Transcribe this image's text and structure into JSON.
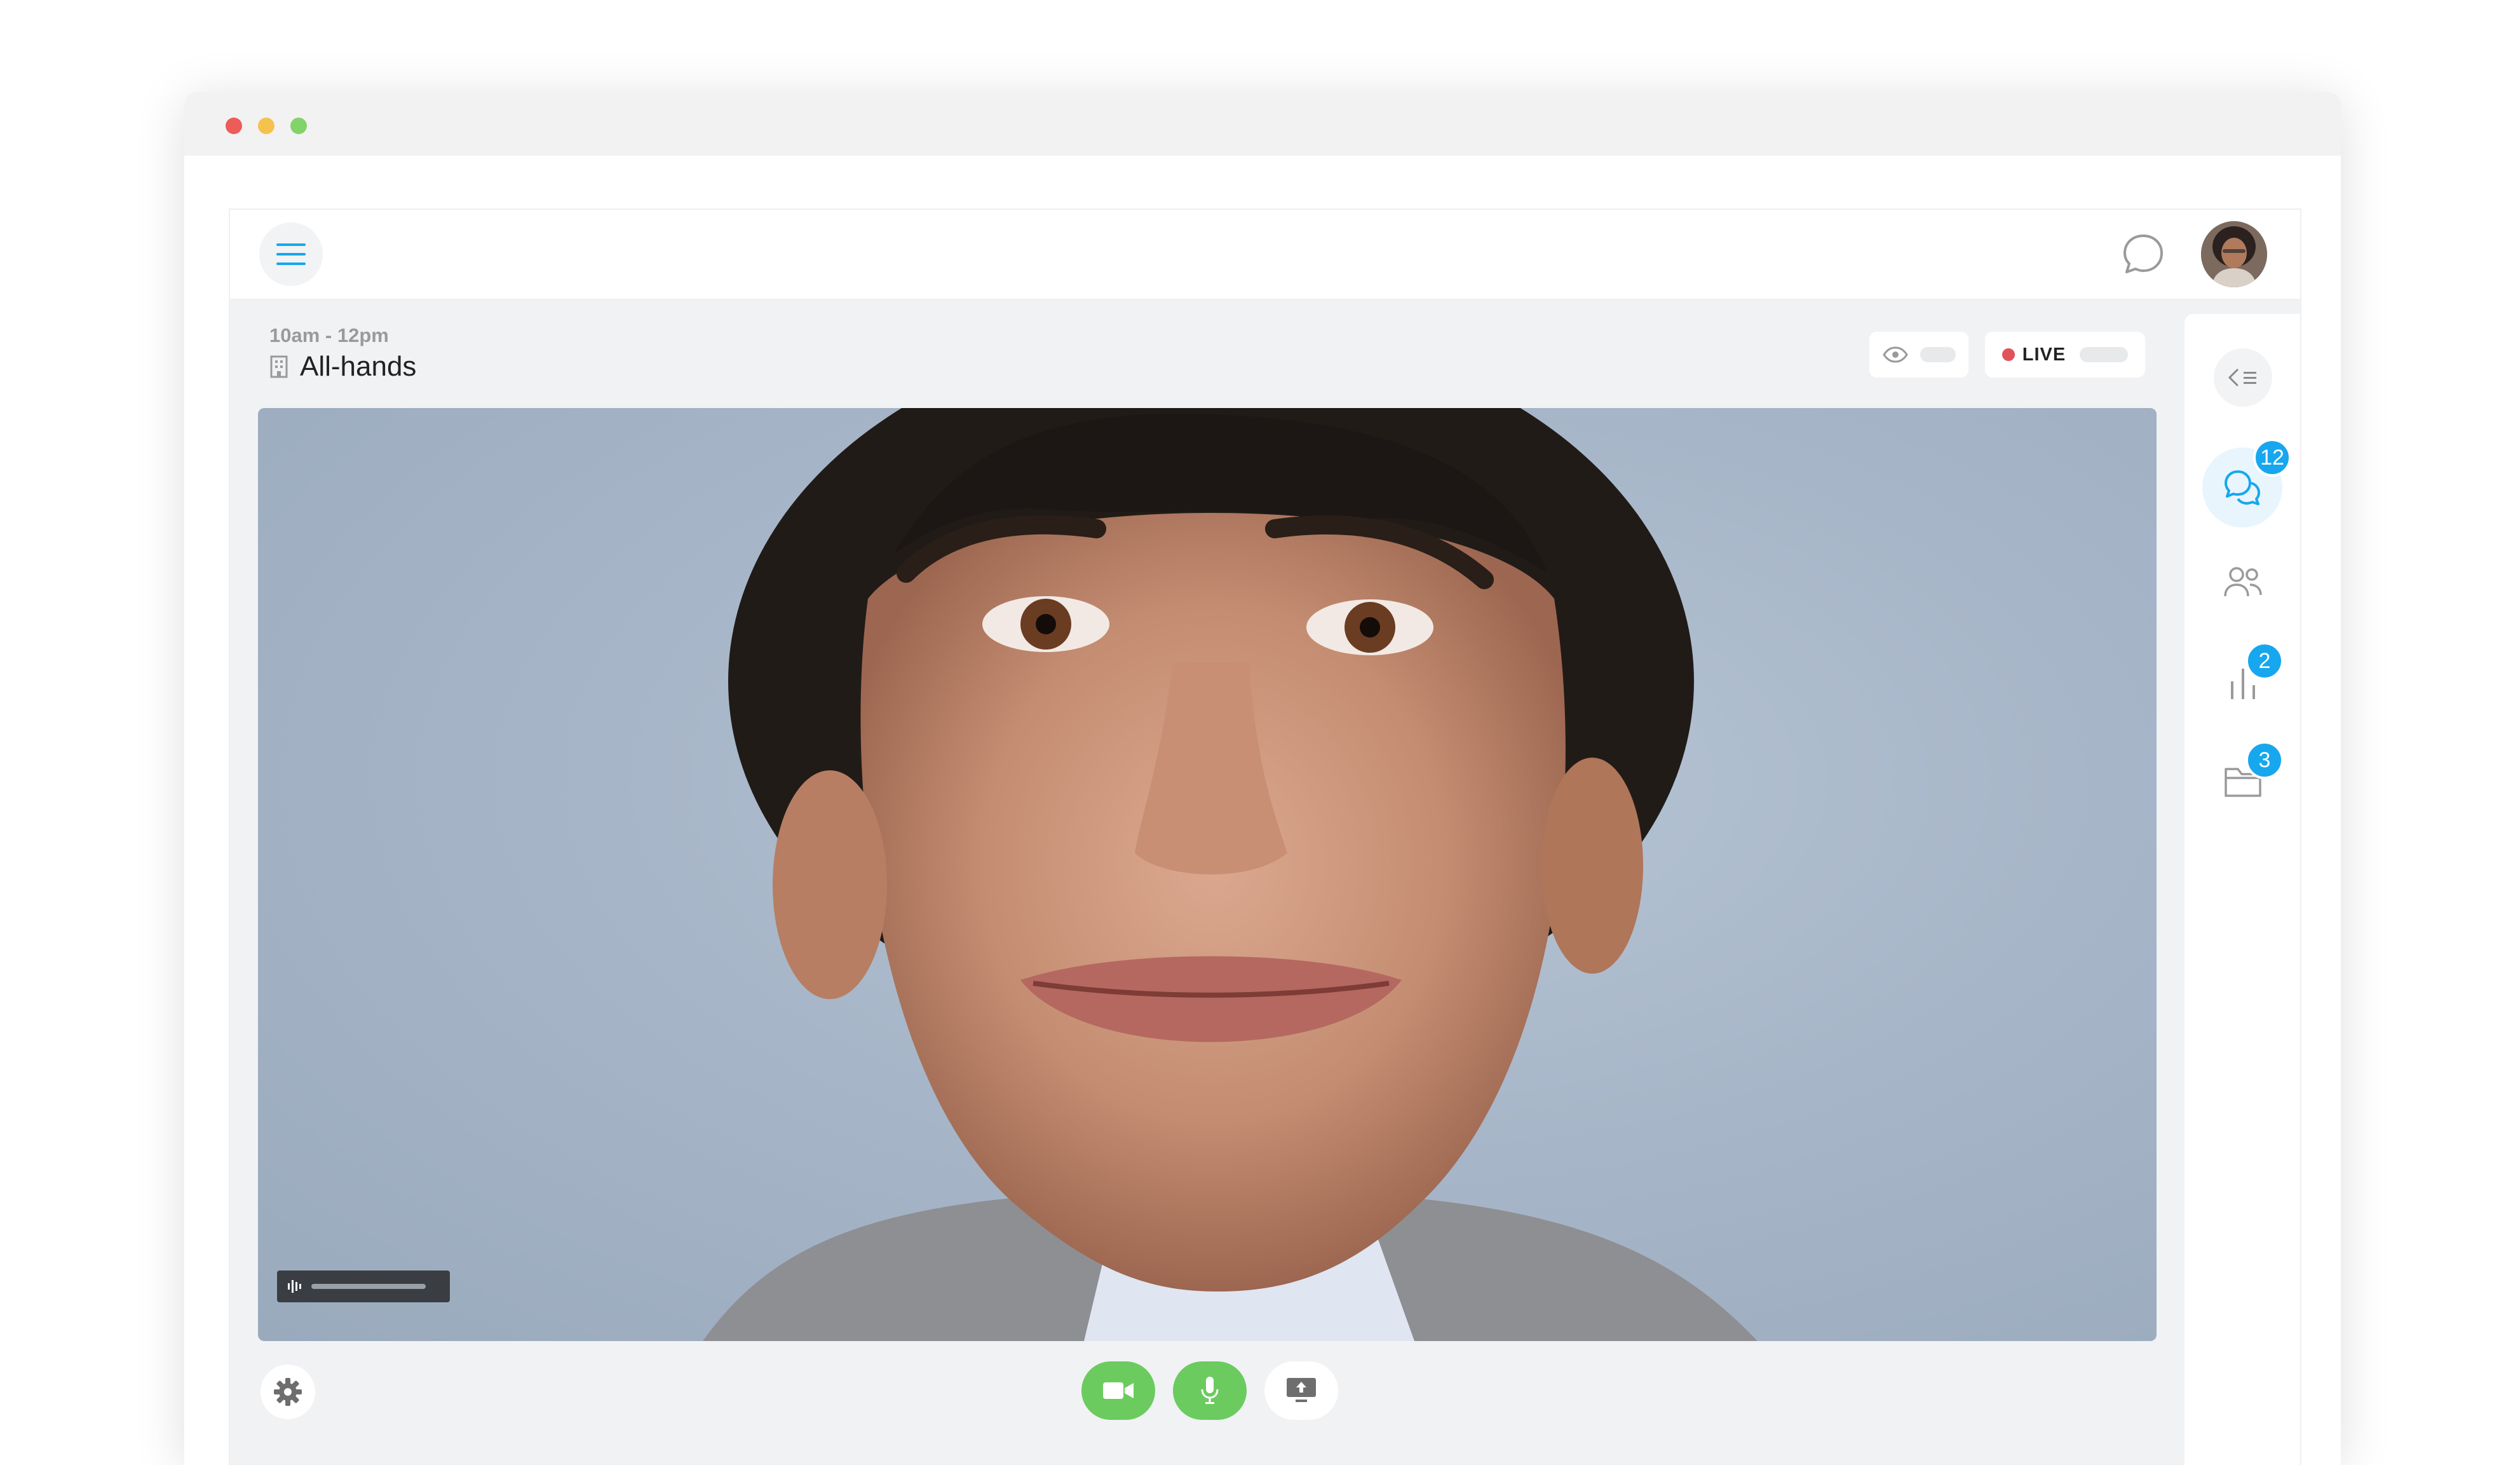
{
  "window": {
    "controls": [
      "close",
      "minimize",
      "maximize"
    ]
  },
  "topnav": {
    "menu_icon": "hamburger-icon",
    "chat_icon": "chat-bubble-icon",
    "avatar_icon": "user-avatar"
  },
  "meeting": {
    "time": "10am - 12pm",
    "title": "All-hands",
    "title_icon": "building-icon"
  },
  "status": {
    "viewers_icon": "eye-icon",
    "live_label": "LIVE",
    "live_color": "#e2525a"
  },
  "video": {
    "audio_icon": "audio-waveform-icon"
  },
  "controls": {
    "settings_icon": "gear-icon",
    "camera_icon": "video-camera-icon",
    "mic_icon": "microphone-icon",
    "share_icon": "screen-share-icon",
    "active_color": "#6ccb5f"
  },
  "sidebar": {
    "collapse_icon": "collapse-panel-icon",
    "items": [
      {
        "name": "chat",
        "icon": "chat-icon",
        "badge": "12",
        "active": true
      },
      {
        "name": "participants",
        "icon": "people-icon",
        "badge": ""
      },
      {
        "name": "polls",
        "icon": "bar-chart-icon",
        "badge": "2"
      },
      {
        "name": "files",
        "icon": "folder-icon",
        "badge": "3"
      }
    ],
    "badge_color": "#16a7ee"
  }
}
